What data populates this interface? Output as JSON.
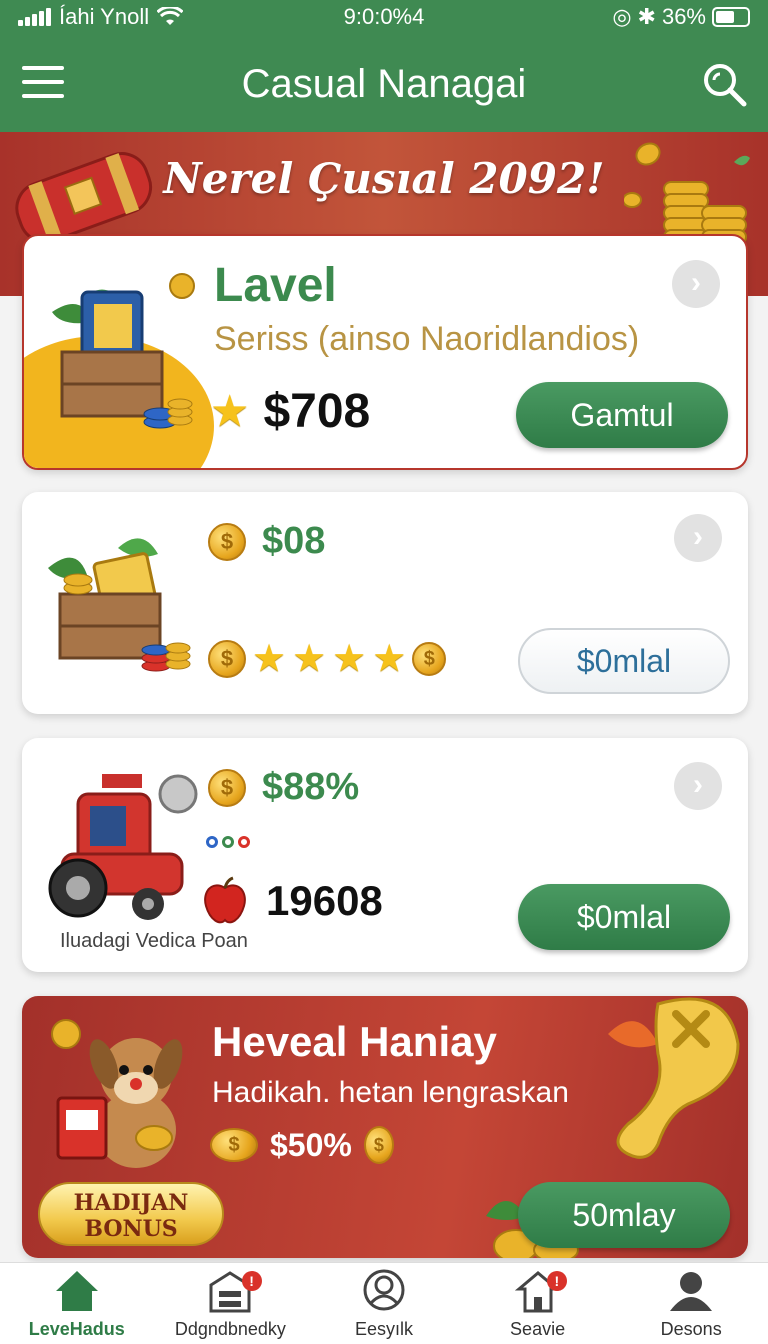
{
  "status_bar": {
    "carrier": "Íahi Ynoll",
    "time": "9:0:0%4",
    "battery": "36%"
  },
  "header": {
    "title": "Casual Nanagai",
    "menu_icon": "hamburger-menu-icon",
    "search_icon": "search-icon"
  },
  "banner": {
    "title": "Nerel Çusıal 2092!"
  },
  "cards": [
    {
      "title": "Lavel",
      "subtitle": "Seriss (ainso Naoridlandios)",
      "price": "$708",
      "button": "Gamtul"
    },
    {
      "price": "$08",
      "stars": 4,
      "button": "$0mlal"
    },
    {
      "price": "$88%",
      "value": "19608",
      "caption": "Iluadagi Vedica Poan",
      "button": "$0mlal"
    },
    {
      "title": "Heveal Haniay",
      "subtitle": "Hadikah. hetan lengraskan",
      "price": "$50%",
      "bonus_line1": "HADIJAN",
      "bonus_line2": "BONUS",
      "button": "50mlay"
    }
  ],
  "nav": {
    "items": [
      {
        "label": "LeveHadus",
        "icon": "home-icon"
      },
      {
        "label": "Ddgndbnedky",
        "icon": "store-icon"
      },
      {
        "label": "Eesyılk",
        "icon": "profile-ring-icon"
      },
      {
        "label": "Seavie",
        "icon": "house-alert-icon"
      },
      {
        "label": "Desons",
        "icon": "user-icon"
      }
    ]
  },
  "colors": {
    "primary_green": "#3f8a52",
    "banner_red": "#b6362c",
    "gold": "#f6c21c",
    "link_blue": "#2d6f9a"
  }
}
